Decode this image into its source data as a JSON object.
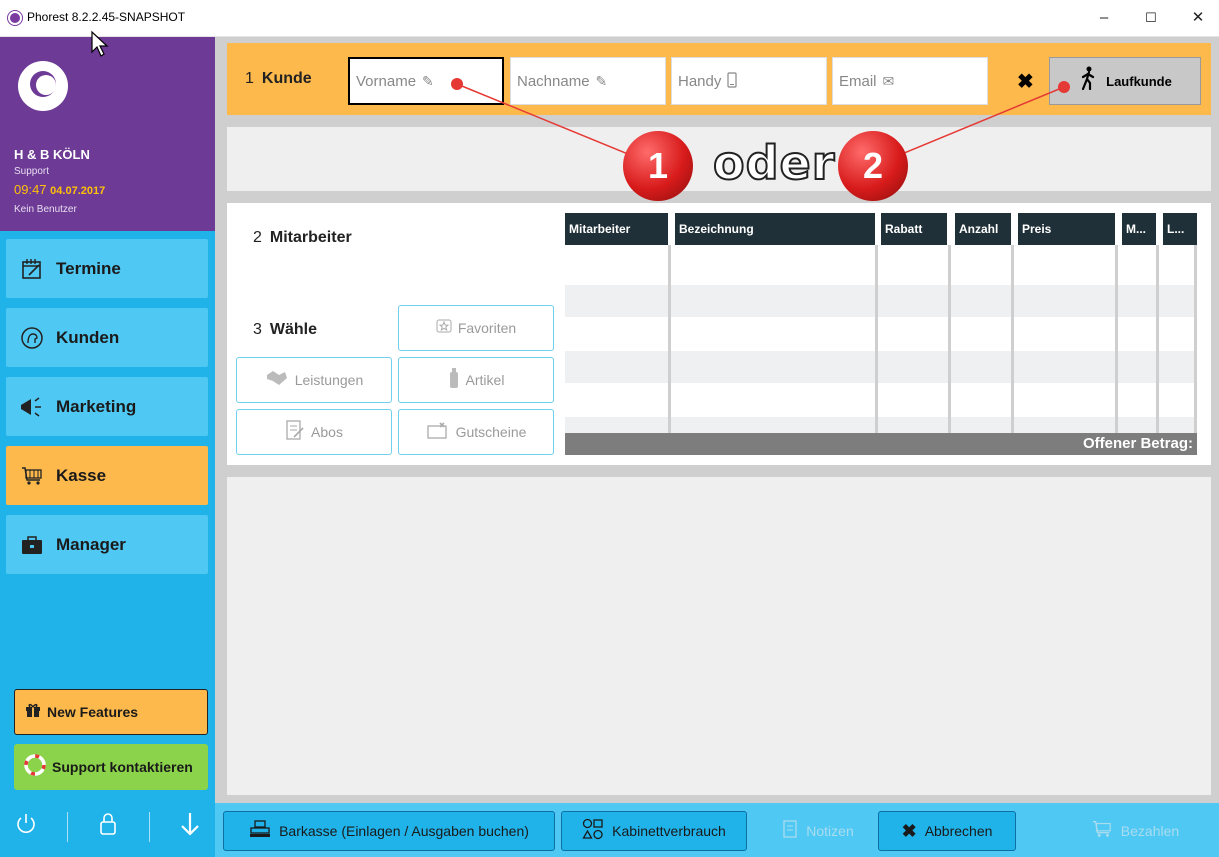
{
  "window": {
    "title": "Phorest 8.2.2.45-SNAPSHOT",
    "controls": {
      "minimize": "–",
      "maximize": "☐",
      "close": "✕"
    }
  },
  "sidebar": {
    "salon": "H & B KÖLN",
    "role": "Support",
    "time": "09:47",
    "date": "04.07.2017",
    "user": "Kein Benutzer",
    "nav": [
      {
        "label": "Termine",
        "icon": "calendar-icon",
        "active": false
      },
      {
        "label": "Kunden",
        "icon": "head-icon",
        "active": false
      },
      {
        "label": "Marketing",
        "icon": "megaphone-icon",
        "active": false
      },
      {
        "label": "Kasse",
        "icon": "cart-icon",
        "active": true
      },
      {
        "label": "Manager",
        "icon": "briefcase-icon",
        "active": false
      }
    ],
    "new_features": "New Features",
    "support": "Support kontaktieren"
  },
  "kunde": {
    "step": "1",
    "label": "Kunde",
    "vorname_placeholder": "Vorname",
    "nachname_placeholder": "Nachname",
    "handy_placeholder": "Handy",
    "email_placeholder": "Email",
    "laufkunde": "Laufkunde"
  },
  "mitarbeiter": {
    "step": "2",
    "label": "Mitarbeiter"
  },
  "waehle": {
    "step": "3",
    "label": "Wähle",
    "buttons": {
      "favoriten": "Favoriten",
      "leistungen": "Leistungen",
      "artikel": "Artikel",
      "abos": "Abos",
      "gutscheine": "Gutscheine"
    }
  },
  "table": {
    "columns": [
      "Mitarbeiter",
      "Bezeichnung",
      "Rabatt",
      "Anzahl",
      "Preis",
      "M...",
      "L..."
    ],
    "footer": "Offener Betrag:"
  },
  "bottom_bar": {
    "barkasse": "Barkasse (Einlagen / Ausgaben buchen)",
    "kabinett": "Kabinettverbrauch",
    "notizen": "Notizen",
    "abbrechen": "Abbrechen",
    "bezahlen": "Bezahlen"
  },
  "annotations": {
    "badge1": "1",
    "oder": "oder",
    "badge2": "2"
  },
  "colors": {
    "purple": "#6d3a96",
    "blue": "#1fb3ea",
    "orange": "#fdb94c",
    "dark_header": "#203038"
  }
}
